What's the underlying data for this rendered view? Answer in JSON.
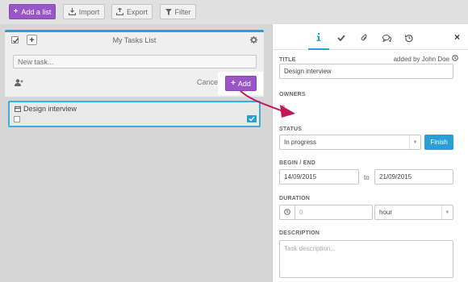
{
  "toolbar": {
    "add_list": "Add a list",
    "import": "Import",
    "export": "Export",
    "filter": "Filter"
  },
  "list_panel": {
    "title": "My Tasks List",
    "new_task_placeholder": "New task...",
    "cancel": "Cancel",
    "add": "Add"
  },
  "task": {
    "title": "Design interview"
  },
  "detail": {
    "tabs": [
      "info-icon",
      "check-icon",
      "paperclip-icon",
      "comments-icon",
      "history-icon"
    ],
    "title_label": "TITLE",
    "added_by": "added by John Doe",
    "title_value": "Design interview",
    "owners_label": "OWNERS",
    "status_label": "STATUS",
    "status_value": "In progress",
    "finish": "Finish",
    "begin_end_label": "BEGIN / END",
    "begin_date": "14/09/2015",
    "to": "to",
    "end_date": "21/09/2015",
    "duration_label": "DURATION",
    "duration_placeholder": "0",
    "duration_unit": "hour",
    "description_label": "DESCRIPTION",
    "description_placeholder": "Task description..."
  },
  "colors": {
    "purple": "#9a55c7",
    "blue": "#2a9fd6",
    "arrow": "#c2185b"
  }
}
